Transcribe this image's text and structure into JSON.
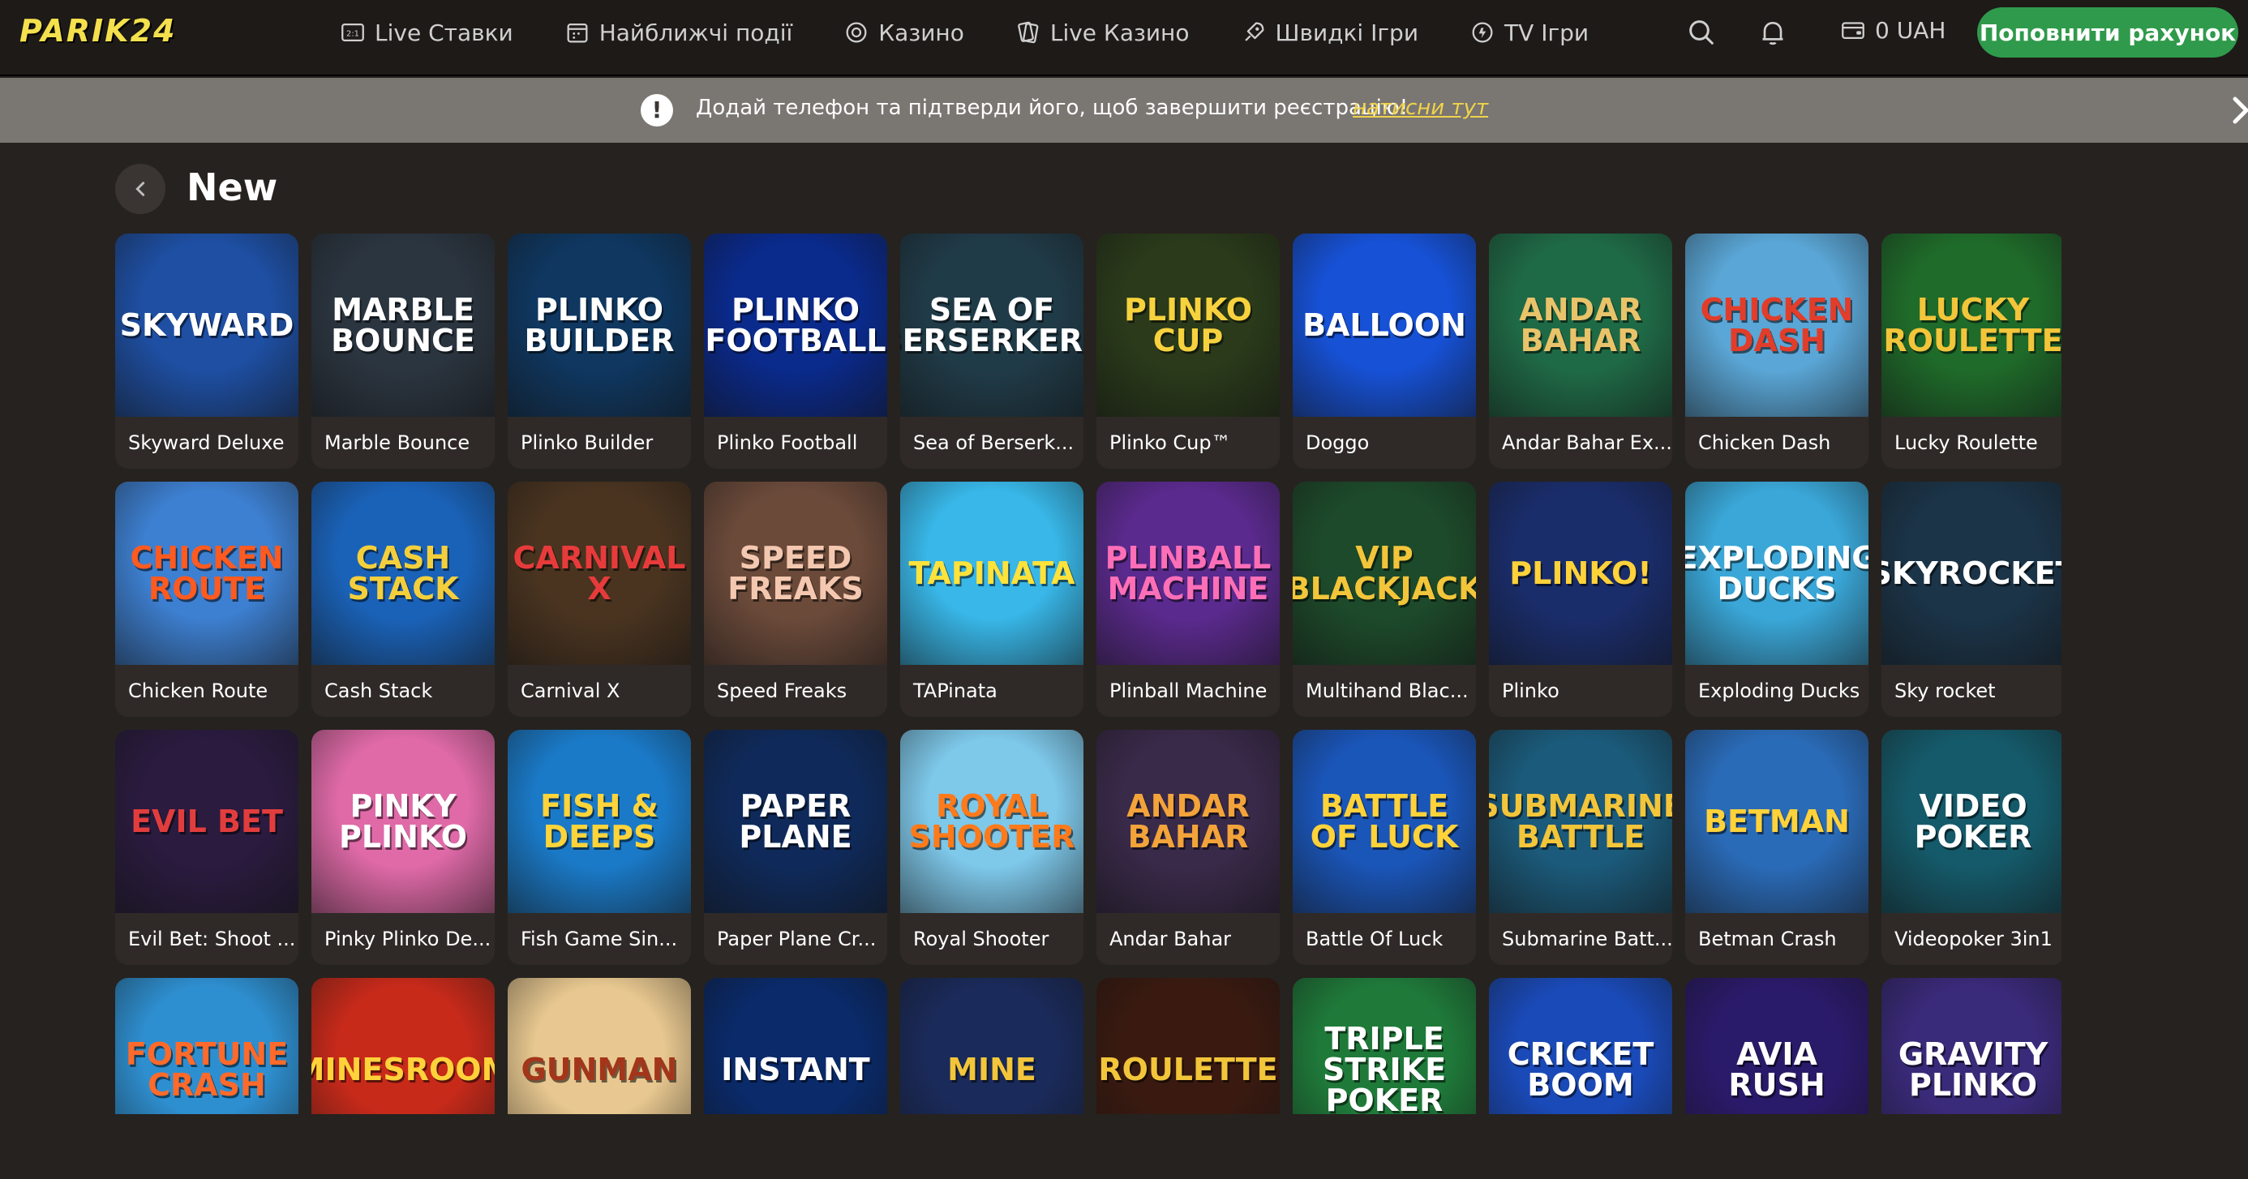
{
  "brand": {
    "logo": "PARIK24"
  },
  "nav": [
    {
      "label": "Live Ставки",
      "icon": "live-bets-icon"
    },
    {
      "label": "Найближчі події",
      "icon": "calendar-icon"
    },
    {
      "label": "Казино",
      "icon": "casino-chip-icon"
    },
    {
      "label": "Live Казино",
      "icon": "cards-icon"
    },
    {
      "label": "Швидкі Ігри",
      "icon": "rocket-icon"
    },
    {
      "label": "TV Ігри",
      "icon": "tv-games-icon"
    }
  ],
  "header": {
    "balance": "0 UAH",
    "deposit_label": "Поповнити рахунок"
  },
  "notice": {
    "text": "Додай телефон та підтверди його, щоб завершити реєстрацію!",
    "link": "натисни тут"
  },
  "section": {
    "title": "New"
  },
  "colors": {
    "accent": "#2f9a4b",
    "logo": "#f4e04d",
    "link": "#f0d34a",
    "background": "#26221f"
  },
  "games": [
    {
      "label": "Skyward Deluxe",
      "art": "Skyward",
      "bg": "#1e4fa3",
      "fg": "#ffffff"
    },
    {
      "label": "Marble Bounce",
      "art": "MARBLE BOUNCE",
      "bg": "#2b3540",
      "fg": "#ffffff"
    },
    {
      "label": "Plinko Builder",
      "art": "PLINKO BUILDER",
      "bg": "#0f3760",
      "fg": "#ffffff"
    },
    {
      "label": "Plinko Football",
      "art": "PLINKO FOOTBALL",
      "bg": "#0a2a8c",
      "fg": "#ffffff"
    },
    {
      "label": "Sea of Berserk...",
      "art": "SEA OF BERSERKERS",
      "bg": "#203b48",
      "fg": "#ffffff"
    },
    {
      "label": "Plinko Cup™",
      "art": "PLINKO CUP",
      "bg": "#2a3a1a",
      "fg": "#f7d23e"
    },
    {
      "label": "Doggo",
      "art": "BALLOON",
      "bg": "#1651d6",
      "fg": "#ffffff"
    },
    {
      "label": "Andar Bahar Ex...",
      "art": "Andar Bahar",
      "bg": "#1f6a46",
      "fg": "#e8c36a"
    },
    {
      "label": "Chicken Dash",
      "art": "CHICKEN DASH",
      "bg": "#5aa6d6",
      "fg": "#e23d2a"
    },
    {
      "label": "Lucky Roulette",
      "art": "LUCKY ROULETTE",
      "bg": "#1f6b2a",
      "fg": "#f2c53a"
    },
    {
      "label": "Chicken Route",
      "art": "CHICKEN ROUTE",
      "bg": "#3d7fd0",
      "fg": "#ff5a1f"
    },
    {
      "label": "Cash Stack",
      "art": "CASH STACK",
      "bg": "#1a62b8",
      "fg": "#f4cf3c"
    },
    {
      "label": "Carnival X",
      "art": "CARNIVAL X",
      "bg": "#4a3420",
      "fg": "#e73b3b"
    },
    {
      "label": "Speed Freaks",
      "art": "SPEED FREAKS",
      "bg": "#6b4a3a",
      "fg": "#f4c8b0"
    },
    {
      "label": "TAPinata",
      "art": "TAPINATA",
      "bg": "#38b7e8",
      "fg": "#ffe23a"
    },
    {
      "label": "Plinball Machine",
      "art": "PLINBALL MACHINE",
      "bg": "#5b2a8e",
      "fg": "#ff6fb8"
    },
    {
      "label": "Multihand Blac...",
      "art": "VIP BLACKJACK",
      "bg": "#1d4a2a",
      "fg": "#f2c53a"
    },
    {
      "label": "Plinko",
      "art": "PLINKO!",
      "bg": "#1a2d6b",
      "fg": "#ffd23a"
    },
    {
      "label": "Exploding Ducks",
      "art": "EXPLODING DUCKS",
      "bg": "#3aa7d8",
      "fg": "#ffffff"
    },
    {
      "label": "Sky rocket",
      "art": "SKYROCKET",
      "bg": "#1b3448",
      "fg": "#ffffff"
    },
    {
      "label": "Evil Bet: Shoot ...",
      "art": "EVIL BET",
      "bg": "#2a1b3f",
      "fg": "#e23d3d"
    },
    {
      "label": "Pinky Plinko De...",
      "art": "PINKY PLINKO",
      "bg": "#e06aa8",
      "fg": "#ffffff"
    },
    {
      "label": "Fish Game Sin...",
      "art": "FISH & DEEPS",
      "bg": "#1a7ac8",
      "fg": "#ffd43a"
    },
    {
      "label": "Paper Plane Cr...",
      "art": "PAPER PLANE",
      "bg": "#0f2a5a",
      "fg": "#ffffff"
    },
    {
      "label": "Royal Shooter",
      "art": "ROYAL SHOOTER",
      "bg": "#7ec8ea",
      "fg": "#ff7a1a"
    },
    {
      "label": "Andar Bahar",
      "art": "ANDAR BAHAR",
      "bg": "#3a2a4a",
      "fg": "#f2a33a"
    },
    {
      "label": "Battle Of Luck",
      "art": "BATTLE OF LUCK",
      "bg": "#1a55b8",
      "fg": "#ffd23a"
    },
    {
      "label": "Submarine Batt...",
      "art": "SUBMARINE BATTLE",
      "bg": "#1b5a7a",
      "fg": "#f2c53a"
    },
    {
      "label": "Betman Crash",
      "art": "BETMAN",
      "bg": "#2a6bb8",
      "fg": "#ffd23a"
    },
    {
      "label": "Videopoker 3in1",
      "art": "Video Poker",
      "bg": "#155a6a",
      "fg": "#ffffff"
    },
    {
      "label": "",
      "art": "FORTUNE CRASH",
      "bg": "#2e8fd0",
      "fg": "#ff6a2a"
    },
    {
      "label": "",
      "art": "MINESROOM",
      "bg": "#c82a1a",
      "fg": "#ffd23a"
    },
    {
      "label": "",
      "art": "GUNMAN",
      "bg": "#e8c890",
      "fg": "#a3361a"
    },
    {
      "label": "",
      "art": "INSTANT",
      "bg": "#0a2a6a",
      "fg": "#ffffff"
    },
    {
      "label": "",
      "art": "MINE",
      "bg": "#1a2a5a",
      "fg": "#f2c53a"
    },
    {
      "label": "",
      "art": "ROULETTE",
      "bg": "#3a1a10",
      "fg": "#f2c53a"
    },
    {
      "label": "",
      "art": "Triple Strike Poker",
      "bg": "#1f7a3a",
      "fg": "#ffffff"
    },
    {
      "label": "",
      "art": "CRICKET BOOM",
      "bg": "#1a4ab8",
      "fg": "#ffffff"
    },
    {
      "label": "",
      "art": "AVIA RUSH",
      "bg": "#2a1a6a",
      "fg": "#ffffff"
    },
    {
      "label": "",
      "art": "GRAVITY PLINKO",
      "bg": "#3a2a7a",
      "fg": "#ffffff"
    }
  ]
}
